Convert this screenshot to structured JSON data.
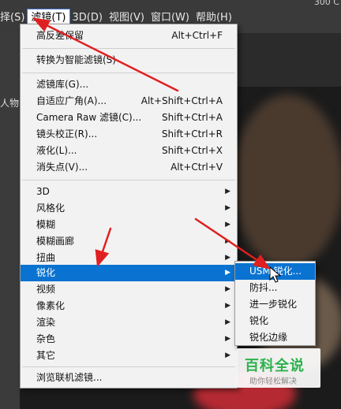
{
  "menubar": {
    "items": [
      {
        "label": "择(S)"
      },
      {
        "label": "滤镜(T)"
      },
      {
        "label": "3D(D)"
      },
      {
        "label": "视图(V)"
      },
      {
        "label": "窗口(W)"
      },
      {
        "label": "帮助(H)"
      }
    ],
    "corner_text": "300 C"
  },
  "leftstrip": {
    "text": "人物"
  },
  "filter_menu": {
    "items": [
      {
        "label": "高反差保留",
        "shortcut": "Alt+Ctrl+F"
      },
      {
        "label": "转换为智能滤镜(S)",
        "shortcut": ""
      },
      {
        "label": "滤镜库(G)...",
        "shortcut": ""
      },
      {
        "label": "自适应广角(A)...",
        "shortcut": "Alt+Shift+Ctrl+A"
      },
      {
        "label": "Camera Raw 滤镜(C)...",
        "shortcut": "Shift+Ctrl+A"
      },
      {
        "label": "镜头校正(R)...",
        "shortcut": "Shift+Ctrl+R"
      },
      {
        "label": "液化(L)...",
        "shortcut": "Shift+Ctrl+X"
      },
      {
        "label": "消失点(V)...",
        "shortcut": "Alt+Ctrl+V"
      },
      {
        "label": "3D"
      },
      {
        "label": "风格化"
      },
      {
        "label": "模糊"
      },
      {
        "label": "模糊画廊"
      },
      {
        "label": "扭曲"
      },
      {
        "label": "锐化"
      },
      {
        "label": "视频"
      },
      {
        "label": "像素化"
      },
      {
        "label": "渲染"
      },
      {
        "label": "杂色"
      },
      {
        "label": "其它"
      },
      {
        "label": "浏览联机滤镜..."
      }
    ]
  },
  "sharpen_submenu": {
    "items": [
      {
        "label": "USM 锐化..."
      },
      {
        "label": "防抖..."
      },
      {
        "label": "进一步锐化"
      },
      {
        "label": "锐化"
      },
      {
        "label": "锐化边缘"
      }
    ]
  },
  "watermark": {
    "title": "百科全说",
    "subtitle": "助你轻松解决"
  },
  "colors": {
    "highlight": "#0a73d1",
    "menu_bg": "#f2f2f2",
    "annotation": "#e02020",
    "watermark_green": "#2bb24c"
  }
}
